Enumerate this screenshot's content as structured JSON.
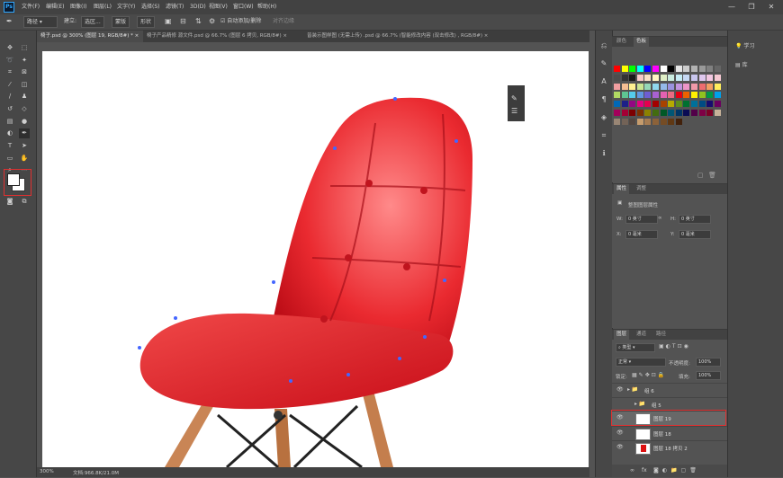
{
  "app": {
    "logo": "Ps"
  },
  "menu": [
    "文件(F)",
    "编辑(E)",
    "图像(I)",
    "图层(L)",
    "文字(Y)",
    "选择(S)",
    "滤镜(T)",
    "3D(D)",
    "视图(V)",
    "窗口(W)",
    "帮助(H)"
  ],
  "window_controls": {
    "minimize": "—",
    "restore": "❐",
    "close": "✕"
  },
  "options": {
    "tool_mode": "路径",
    "make_label": "建立:",
    "selection_btn": "选区...",
    "mask_btn": "蒙版",
    "shape_btn": "形状",
    "auto_add_delete": "自动添加/删除",
    "align_edges": "对齐边缘"
  },
  "tabs": [
    {
      "label": "椅子.psd @ 300% (图层 19, RGB/8#) *",
      "close": "×"
    },
    {
      "label": "椅子产品精修 源文件.psd @ 66.7% (图层 6 拷贝, RGB/8#)",
      "close": "×"
    },
    {
      "label": "皆装示图样图 (无需上传) .psd @ 66.7% (智能修改内容 (双击修改) , RGB/8#)",
      "close": "×"
    }
  ],
  "status": {
    "zoom": "300%",
    "doc": "文档:966.8K/21.0M"
  },
  "color_panel": {
    "tabs": [
      "颜色",
      "色板"
    ],
    "active_tab": 1,
    "swatches": [
      [
        "#ff0000",
        "#ffff00",
        "#00ff00",
        "#00ffff",
        "#0000ff",
        "#ff00ff",
        "#ffffff",
        "#000000",
        "#e6e6e6",
        "#cccccc",
        "#b3b3b3",
        "#999999",
        "#808080",
        "#666666"
      ],
      [
        "#4d4d4d",
        "#333333",
        "#1a1a1a",
        "#f7c8c8",
        "#f9dfc6",
        "#fff5c4",
        "#dff0c6",
        "#c9ecdf",
        "#c6ecf5",
        "#c7d9f4",
        "#c9c6ee",
        "#dfc7ee",
        "#f2c7e1",
        "#f5c8d2"
      ],
      [
        "#f19ea0",
        "#f6be92",
        "#fff191",
        "#c9e593",
        "#95d7b7",
        "#8fd9ef",
        "#94b9e9",
        "#9b92df",
        "#c294df",
        "#ec95c8",
        "#f09aa9",
        "#ed6d6f",
        "#f39e63",
        "#ffed5d"
      ],
      [
        "#b1da62",
        "#5ec693",
        "#55cbe9",
        "#6097df",
        "#6e5ed1",
        "#a961d1",
        "#e561b1",
        "#ea6b82",
        "#e60012",
        "#eb6100",
        "#fff100",
        "#8fc31f",
        "#009944",
        "#00a0e9"
      ],
      [
        "#0068b7",
        "#1d2088",
        "#920783",
        "#e4007f",
        "#e5004f",
        "#a40000",
        "#a84200",
        "#b7aa00",
        "#5f8e1c",
        "#007130",
        "#00709a",
        "#004b83",
        "#160c6e",
        "#6a005f"
      ],
      [
        "#a4005b",
        "#a40035",
        "#7d0000",
        "#7d3000",
        "#8c8200",
        "#436c0f",
        "#005826",
        "#005675",
        "#003566",
        "#0a0c54",
        "#520049",
        "#7e0045",
        "#7d0026",
        "#c7b299"
      ],
      [
        "#998675",
        "#736357",
        "#534741",
        "#c69c6d",
        "#a67c52",
        "#8c6239",
        "#754c24",
        "#603813",
        "#42210b"
      ]
    ]
  },
  "properties_panel": {
    "tabs": [
      "属性",
      "调整"
    ],
    "title": "整图图层属性",
    "w_label": "W:",
    "w_value": "0 英寸",
    "link_icon": "∞",
    "h_label": "H:",
    "h_value": "0 英寸",
    "x_label": "X:",
    "x_value": "0 毫米",
    "y_label": "Y:",
    "y_value": "0 毫米"
  },
  "layers_panel": {
    "tabs": [
      "图层",
      "通道",
      "路径"
    ],
    "filter_kind": "类型",
    "blend_mode": "正常",
    "opacity_label": "不透明度:",
    "opacity_value": "100%",
    "lock_label": "锁定:",
    "fill_label": "填充:",
    "fill_value": "100%",
    "layers": [
      {
        "name": "组 6",
        "type": "group",
        "visible": true
      },
      {
        "name": "组 5",
        "type": "group",
        "visible": false
      },
      {
        "name": "图层 19",
        "type": "layer",
        "visible": true,
        "selected": true
      },
      {
        "name": "图层 18",
        "type": "layer",
        "visible": true
      },
      {
        "name": "图层 18 拷贝 2",
        "type": "layer",
        "visible": true
      }
    ],
    "bottom_icons": [
      "fx"
    ]
  },
  "right_column": {
    "learn": "学习",
    "library": "库"
  }
}
